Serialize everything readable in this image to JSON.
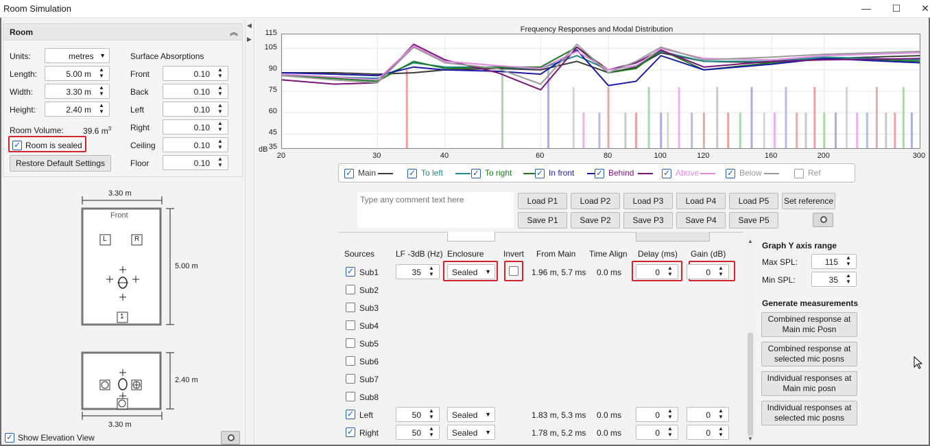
{
  "window": {
    "title": "Room Simulation",
    "minimize": "—",
    "maximize": "☐",
    "close": "✕"
  },
  "room": {
    "header": "Room",
    "units_label": "Units:",
    "units_value": "metres",
    "length_label": "Length:",
    "length_value": "5.00 m",
    "width_label": "Width:",
    "width_value": "3.30 m",
    "height_label": "Height:",
    "height_value": "2.40 m",
    "volume_label": "Room Volume:",
    "volume_value": "39.6 m",
    "volume_sup": "3",
    "sealed_label": "Room is sealed",
    "restore_button": "Restore Default Settings",
    "surface_header": "Surface Absorptions",
    "surfaces": [
      {
        "label": "Front",
        "value": "0.10"
      },
      {
        "label": "Back",
        "value": "0.10"
      },
      {
        "label": "Left",
        "value": "0.10"
      },
      {
        "label": "Right",
        "value": "0.10"
      },
      {
        "label": "Ceiling",
        "value": "0.10"
      },
      {
        "label": "Floor",
        "value": "0.10"
      }
    ]
  },
  "plan": {
    "top_width": "3.30 m",
    "length": "5.00 m",
    "front": "Front",
    "spk_left": "L",
    "spk_right": "R",
    "sub": "1",
    "elev_height": "2.40 m",
    "elev_width": "3.30 m"
  },
  "show_elevation": "Show Elevation View",
  "chart_data": {
    "type": "line",
    "title": "Frequency Responses and Modal Distribution",
    "ylabel": "dB",
    "yticks": [
      "115",
      "105",
      "90",
      "75",
      "60",
      "45",
      "35"
    ],
    "xticks": [
      "20",
      "30",
      "40",
      "60",
      "80",
      "100",
      "120",
      "160",
      "200",
      "300"
    ],
    "xlim": [
      20,
      300
    ],
    "ylim": [
      35,
      115
    ],
    "series": [
      {
        "name": "Main",
        "color": "#3c3c3c",
        "x": [
          20,
          25,
          30,
          35,
          40,
          50,
          60,
          70,
          80,
          90,
          100,
          120,
          160,
          200,
          300
        ],
        "values": [
          88,
          88,
          87,
          88,
          90,
          91,
          90,
          96,
          88,
          92,
          102,
          96,
          95,
          98,
          100
        ]
      },
      {
        "name": "To left",
        "color": "#1d8b8b",
        "x": [
          20,
          25,
          30,
          35,
          40,
          50,
          60,
          70,
          80,
          90,
          100,
          120,
          160,
          200,
          300
        ],
        "values": [
          86,
          85,
          84,
          95,
          92,
          92,
          91,
          100,
          90,
          93,
          103,
          96,
          96,
          99,
          97
        ]
      },
      {
        "name": "To right",
        "color": "#1f7a1f",
        "x": [
          20,
          25,
          30,
          35,
          40,
          50,
          60,
          70,
          80,
          90,
          100,
          120,
          160,
          200,
          300
        ],
        "values": [
          86,
          84,
          82,
          96,
          91,
          92,
          92,
          106,
          88,
          91,
          104,
          90,
          95,
          98,
          96
        ]
      },
      {
        "name": "In front",
        "color": "#1a1aa8",
        "x": [
          20,
          25,
          30,
          35,
          40,
          50,
          60,
          70,
          80,
          90,
          100,
          120,
          160,
          200,
          300
        ],
        "values": [
          88,
          87,
          86,
          92,
          90,
          89,
          87,
          104,
          79,
          82,
          100,
          90,
          94,
          98,
          95
        ]
      },
      {
        "name": "Behind",
        "color": "#7a137a",
        "x": [
          20,
          25,
          30,
          35,
          40,
          50,
          60,
          70,
          80,
          90,
          100,
          120,
          160,
          200,
          300
        ],
        "values": [
          83,
          80,
          81,
          108,
          97,
          88,
          76,
          106,
          90,
          95,
          104,
          92,
          96,
          97,
          98
        ]
      },
      {
        "name": "Above",
        "color": "#e08be0",
        "x": [
          20,
          25,
          30,
          35,
          40,
          50,
          60,
          70,
          80,
          90,
          100,
          120,
          160,
          200,
          300
        ],
        "values": [
          87,
          85,
          83,
          107,
          96,
          93,
          91,
          103,
          90,
          93,
          105,
          98,
          97,
          100,
          102
        ]
      },
      {
        "name": "Below",
        "color": "#9a9a9a",
        "x": [
          20,
          25,
          30,
          35,
          40,
          50,
          60,
          70,
          80,
          90,
          100,
          120,
          160,
          200,
          300
        ],
        "values": [
          86,
          83,
          81,
          106,
          95,
          91,
          80,
          108,
          88,
          96,
          106,
          97,
          99,
          101,
          103
        ]
      }
    ],
    "ref_label": "Ref"
  },
  "comment_placeholder": "Type any comment text here",
  "load_buttons": [
    "Load P1",
    "Load P2",
    "Load P3",
    "Load P4",
    "Load P5"
  ],
  "save_buttons": [
    "Save P1",
    "Save P2",
    "Save P3",
    "Save P4",
    "Save P5"
  ],
  "set_reference": "Set reference",
  "sources": {
    "headers": {
      "sources": "Sources",
      "lf": "LF -3dB (Hz)",
      "enclosure": "Enclosure",
      "invert": "Invert",
      "from_main": "From Main",
      "time_align": "Time Align",
      "delay": "Delay (ms)",
      "gain": "Gain (dB)"
    },
    "rows": [
      {
        "name": "Sub1",
        "checked": true,
        "lf": "35",
        "enclosure": "Sealed",
        "from_main": "1.96 m, 5.7 ms",
        "time_align": "0.0 ms",
        "delay": "0",
        "gain": "0"
      },
      {
        "name": "Sub2",
        "checked": false
      },
      {
        "name": "Sub3",
        "checked": false
      },
      {
        "name": "Sub4",
        "checked": false
      },
      {
        "name": "Sub5",
        "checked": false
      },
      {
        "name": "Sub6",
        "checked": false
      },
      {
        "name": "Sub7",
        "checked": false
      },
      {
        "name": "Sub8",
        "checked": false
      },
      {
        "name": "Left",
        "checked": true,
        "lf": "50",
        "enclosure": "Sealed",
        "from_main": "1.83 m, 5.3 ms",
        "time_align": "0.0 ms",
        "delay": "0",
        "gain": "0"
      },
      {
        "name": "Right",
        "checked": true,
        "lf": "50",
        "enclosure": "Sealed",
        "from_main": "1.78 m, 5.2 ms",
        "time_align": "0.0 ms",
        "delay": "0",
        "gain": "0"
      }
    ]
  },
  "graph_axis": {
    "header": "Graph Y axis range",
    "max_label": "Max SPL:",
    "max_value": "115",
    "min_label": "Min SPL:",
    "min_value": "35"
  },
  "generate": {
    "header": "Generate measurements",
    "buttons": [
      {
        "line1": "Combined response at",
        "line2": "Main mic Posn"
      },
      {
        "line1": "Combined response at",
        "line2": "selected mic posns"
      },
      {
        "line1": "Individual responses at",
        "line2": "Main mic posn"
      },
      {
        "line1": "Individual responses at",
        "line2": "selected mic posns"
      }
    ]
  }
}
